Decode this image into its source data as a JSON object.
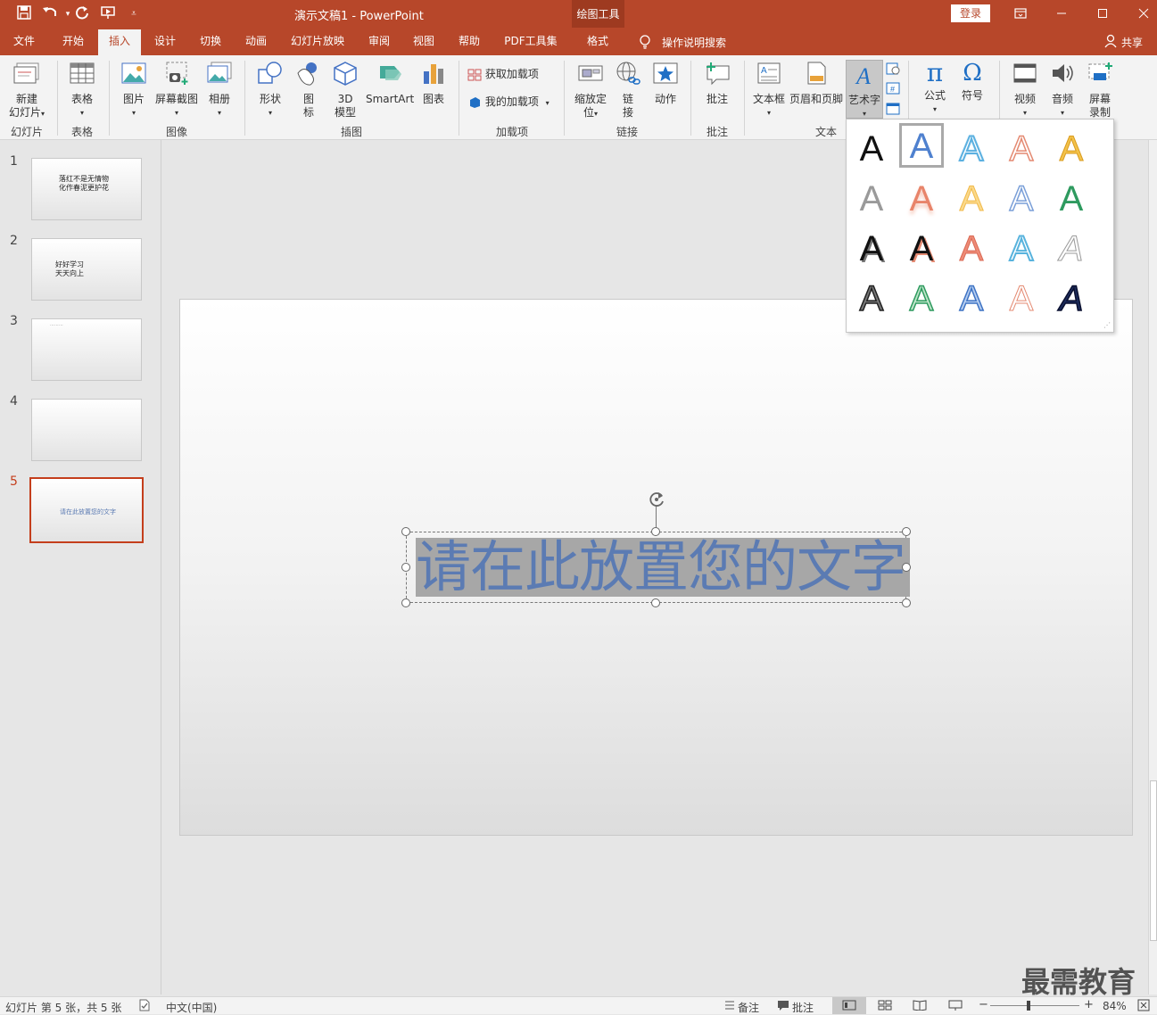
{
  "titlebar": {
    "title": "演示文稿1  -  PowerPoint",
    "context_group": "绘图工具",
    "login": "登录"
  },
  "tabs": [
    "文件",
    "开始",
    "插入",
    "设计",
    "切换",
    "动画",
    "幻灯片放映",
    "审阅",
    "视图",
    "帮助",
    "PDF工具集",
    "格式"
  ],
  "tell_me": "操作说明搜索",
  "share": "共享",
  "ribbon": {
    "new_slide": "新建",
    "new_slide2": "幻灯片",
    "grp_slides": "幻灯片",
    "table": "表格",
    "grp_table": "表格",
    "picture": "图片",
    "screenshot": "屏幕截图",
    "album": "相册",
    "grp_images": "图像",
    "shapes": "形状",
    "icons1": "图",
    "icons2": "标",
    "model3d1": "3D",
    "model3d2": "模型",
    "smartart": "SmartArt",
    "chart": "图表",
    "grp_illus": "插图",
    "get_addins": "获取加载项",
    "my_addins": "我的加载项",
    "grp_addins": "加载项",
    "zoom1": "缩放定",
    "zoom2": "位",
    "link1": "链",
    "link2": "接",
    "action": "动作",
    "grp_links": "链接",
    "comment": "批注",
    "grp_comments": "批注",
    "textbox": "文本框",
    "headerfooter": "页眉和页脚",
    "wordart": "艺术字",
    "grp_text": "文本",
    "equation": "公式",
    "symbol": "符号",
    "video": "视频",
    "audio": "音频",
    "screenrec1": "屏幕",
    "screenrec2": "录制"
  },
  "slides": [
    {
      "num": "1",
      "lines": [
        "落红不是无情物",
        "化作春泥更护花"
      ]
    },
    {
      "num": "2",
      "lines": [
        "好好学习",
        "天天向上"
      ]
    },
    {
      "num": "3",
      "lines": [
        "⋯⋯⋯"
      ]
    },
    {
      "num": "4",
      "lines": []
    },
    {
      "num": "5",
      "lines": [
        "请在此放置您的文字"
      ]
    }
  ],
  "canvas_text": "请在此放置您的文字",
  "gallery_letter": "A",
  "watermark": "最需教育",
  "status": {
    "slide_info": "幻灯片 第 5 张，共 5 张",
    "lang": "中文(中国)",
    "notes": "备注",
    "comments": "批注",
    "zoom": "84%"
  },
  "colors": {
    "accent": "#b7472a",
    "selected_text": "#5b7bb3"
  }
}
